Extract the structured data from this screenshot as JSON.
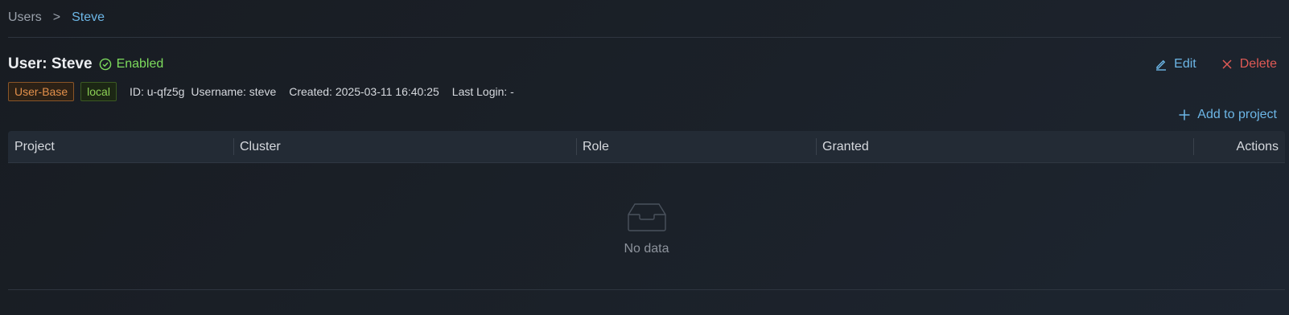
{
  "breadcrumb": {
    "parent": "Users",
    "separator": ">",
    "current": "Steve"
  },
  "header": {
    "title": "User: Steve",
    "status": "Enabled",
    "status_icon": "check-circle-icon",
    "edit_label": "Edit",
    "delete_label": "Delete"
  },
  "meta": {
    "tags": [
      "User-Base",
      "local"
    ],
    "id": "ID: u-qfz5g",
    "username": "Username: steve",
    "created": "Created: 2025-03-11 16:40:25",
    "last_login": "Last Login: -"
  },
  "add_to_project_label": "Add to project",
  "table": {
    "columns": [
      "Project",
      "Cluster",
      "Role",
      "Granted",
      "Actions"
    ],
    "rows": [],
    "empty_text": "No data"
  },
  "colors": {
    "accent": "#6cb6e6",
    "danger": "#e05a55",
    "success": "#7ddc5d",
    "tag_base": "#e3904b",
    "tag_local": "#8ccf55"
  }
}
